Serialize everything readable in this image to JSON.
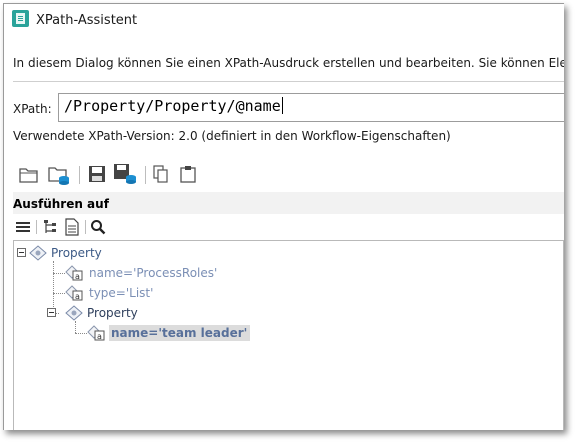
{
  "window": {
    "title": "XPath-Assistent",
    "description": "In diesem Dialog können Sie einen XPath-Ausdruck erstellen und bearbeiten. Sie können Elemen"
  },
  "xpath": {
    "label": "XPath:",
    "value": "/Property/Property/@name",
    "version_text": "Verwendete XPath-Version: 2.0 (definiert in den Workflow-Eigenschaften)"
  },
  "toolbar": {
    "icons": [
      "open-folder-icon",
      "open-database-icon",
      "save-icon",
      "save-database-icon",
      "copy-icon",
      "paste-icon"
    ]
  },
  "execute": {
    "label": "Ausführen auf",
    "icons": [
      "list-icon",
      "tree-structure-icon",
      "document-icon",
      "search-icon"
    ]
  },
  "tree": {
    "nodes": [
      {
        "label": "Property",
        "type": "element",
        "expanded": true
      },
      {
        "label": "name='ProcessRoles'",
        "type": "attribute"
      },
      {
        "label": "type='List'",
        "type": "attribute"
      },
      {
        "label": "Property",
        "type": "element",
        "expanded": true
      },
      {
        "label": "name='team leader'",
        "type": "attribute",
        "selected": true
      }
    ]
  },
  "colors": {
    "accent": "#2aa39a",
    "node_text": "#3c5a86",
    "selection": "#dcdcdc"
  }
}
